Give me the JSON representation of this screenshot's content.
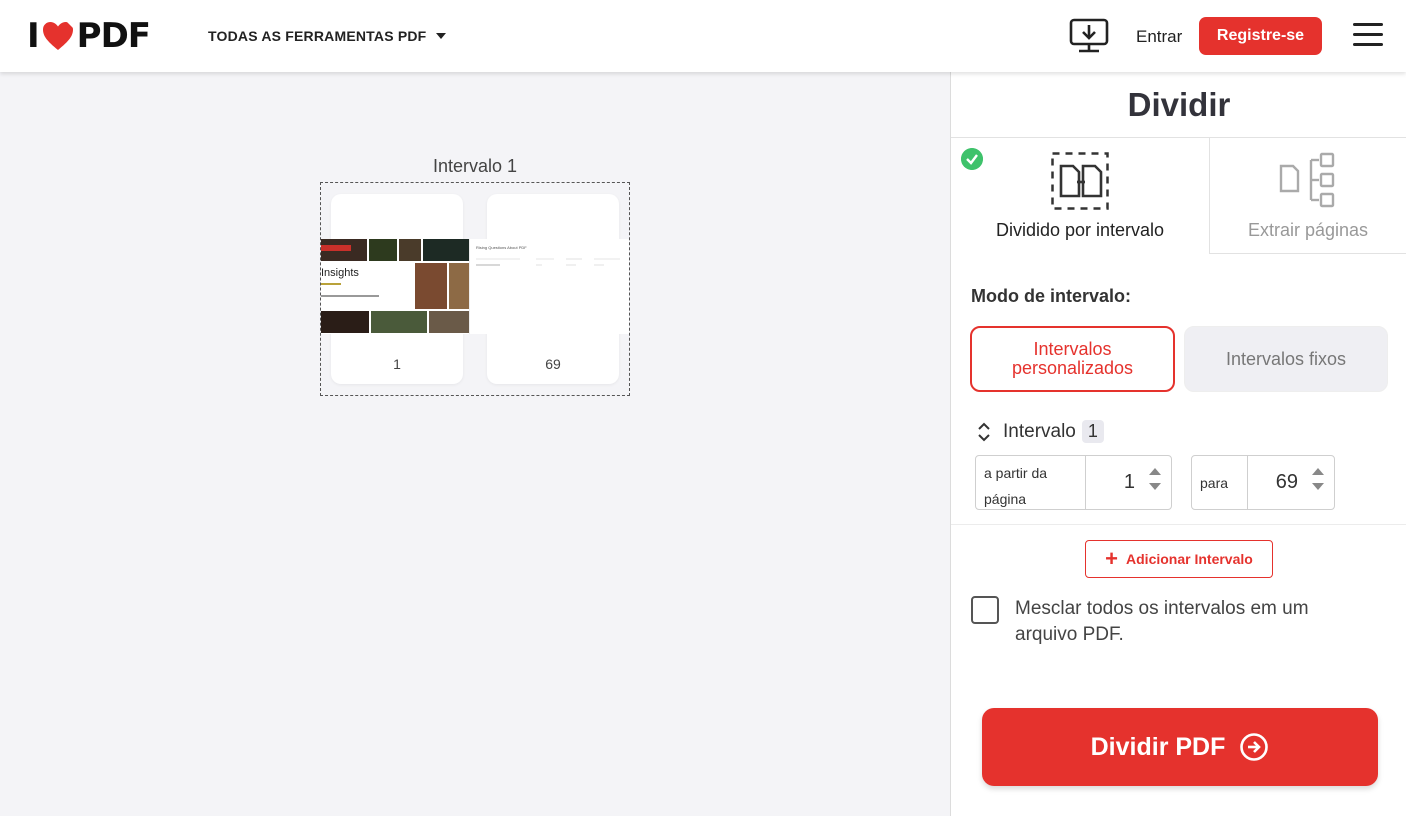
{
  "header": {
    "logo_left": "I",
    "logo_right": "PDF",
    "tools_menu": "TODAS AS FERRAMENTAS PDF",
    "login": "Entrar",
    "register": "Registre-se"
  },
  "canvas": {
    "range_title": "Intervalo 1",
    "pages": [
      {
        "number": "1"
      },
      {
        "number": "69"
      }
    ],
    "thumb1_heading": "Insights",
    "thumb2_heading": "Rising Questions About PDF"
  },
  "sidebar": {
    "title": "Dividir",
    "tabs": [
      {
        "label": "Dividido por intervalo",
        "active": true
      },
      {
        "label": "Extrair páginas",
        "active": false
      }
    ],
    "mode_label": "Modo de intervalo:",
    "mode_custom": "Intervalos personalizados",
    "mode_fixed": "Intervalos fixos",
    "interval_label": "Intervalo",
    "interval_index": "1",
    "from_label": "a partir da página",
    "from_value": "1",
    "to_label": "para",
    "to_value": "69",
    "add_interval": "Adicionar Intervalo",
    "merge_label": "Mesclar todos os intervalos em um arquivo PDF.",
    "split_button": "Dividir PDF"
  },
  "colors": {
    "accent": "#e5322d",
    "success": "#3ec26b"
  }
}
